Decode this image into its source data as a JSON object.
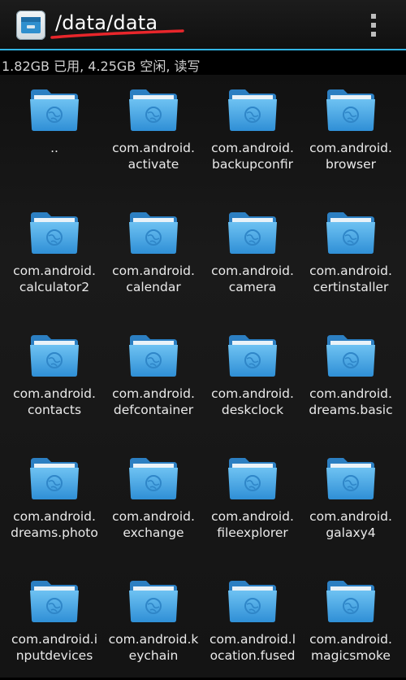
{
  "header": {
    "title": "/data/data",
    "app_icon": "file-manager-icon",
    "menu_icon": "overflow-menu-icon"
  },
  "storage_status": "1.82GB 已用, 4.25GB 空闲, 读写",
  "colors": {
    "accent": "#33b5e5",
    "folder": "#3fa3e0",
    "annotation": "#e8262b"
  },
  "items": [
    {
      "line1": "..",
      "line2": ""
    },
    {
      "line1": "com.android.",
      "line2": "activate"
    },
    {
      "line1": "com.android.",
      "line2": "backupconfir"
    },
    {
      "line1": "com.android.",
      "line2": "browser"
    },
    {
      "line1": "com.android.",
      "line2": "calculator2"
    },
    {
      "line1": "com.android.",
      "line2": "calendar"
    },
    {
      "line1": "com.android.",
      "line2": "camera"
    },
    {
      "line1": "com.android.",
      "line2": "certinstaller"
    },
    {
      "line1": "com.android.",
      "line2": "contacts"
    },
    {
      "line1": "com.android.",
      "line2": "defcontainer"
    },
    {
      "line1": "com.android.",
      "line2": "deskclock"
    },
    {
      "line1": "com.android.",
      "line2": "dreams.basic"
    },
    {
      "line1": "com.android.",
      "line2": "dreams.photo"
    },
    {
      "line1": "com.android.",
      "line2": "exchange"
    },
    {
      "line1": "com.android.",
      "line2": "fileexplorer"
    },
    {
      "line1": "com.android.",
      "line2": "galaxy4"
    },
    {
      "line1": "com.android.i",
      "line2": "nputdevices"
    },
    {
      "line1": "com.android.k",
      "line2": "eychain"
    },
    {
      "line1": "com.android.l",
      "line2": "ocation.fused"
    },
    {
      "line1": "com.android.",
      "line2": "magicsmoke"
    }
  ]
}
